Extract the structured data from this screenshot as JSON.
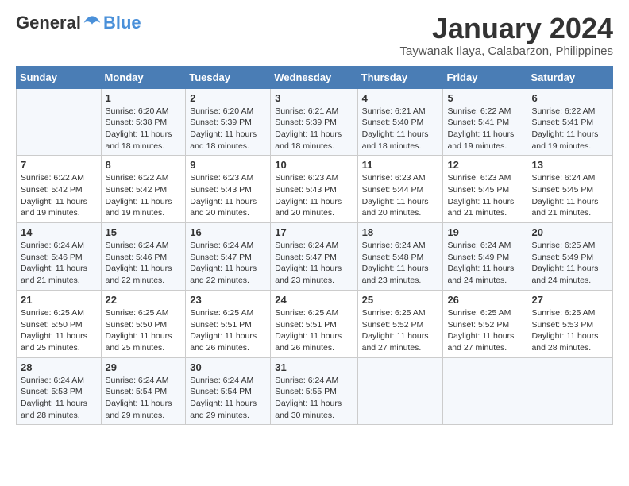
{
  "logo": {
    "text_general": "General",
    "text_blue": "Blue"
  },
  "title": "January 2024",
  "location": "Taywanak Ilaya, Calabarzon, Philippines",
  "headers": [
    "Sunday",
    "Monday",
    "Tuesday",
    "Wednesday",
    "Thursday",
    "Friday",
    "Saturday"
  ],
  "weeks": [
    [
      {
        "day": "",
        "info": ""
      },
      {
        "day": "1",
        "info": "Sunrise: 6:20 AM\nSunset: 5:38 PM\nDaylight: 11 hours\nand 18 minutes."
      },
      {
        "day": "2",
        "info": "Sunrise: 6:20 AM\nSunset: 5:39 PM\nDaylight: 11 hours\nand 18 minutes."
      },
      {
        "day": "3",
        "info": "Sunrise: 6:21 AM\nSunset: 5:39 PM\nDaylight: 11 hours\nand 18 minutes."
      },
      {
        "day": "4",
        "info": "Sunrise: 6:21 AM\nSunset: 5:40 PM\nDaylight: 11 hours\nand 18 minutes."
      },
      {
        "day": "5",
        "info": "Sunrise: 6:22 AM\nSunset: 5:41 PM\nDaylight: 11 hours\nand 19 minutes."
      },
      {
        "day": "6",
        "info": "Sunrise: 6:22 AM\nSunset: 5:41 PM\nDaylight: 11 hours\nand 19 minutes."
      }
    ],
    [
      {
        "day": "7",
        "info": "Sunrise: 6:22 AM\nSunset: 5:42 PM\nDaylight: 11 hours\nand 19 minutes."
      },
      {
        "day": "8",
        "info": "Sunrise: 6:22 AM\nSunset: 5:42 PM\nDaylight: 11 hours\nand 19 minutes."
      },
      {
        "day": "9",
        "info": "Sunrise: 6:23 AM\nSunset: 5:43 PM\nDaylight: 11 hours\nand 20 minutes."
      },
      {
        "day": "10",
        "info": "Sunrise: 6:23 AM\nSunset: 5:43 PM\nDaylight: 11 hours\nand 20 minutes."
      },
      {
        "day": "11",
        "info": "Sunrise: 6:23 AM\nSunset: 5:44 PM\nDaylight: 11 hours\nand 20 minutes."
      },
      {
        "day": "12",
        "info": "Sunrise: 6:23 AM\nSunset: 5:45 PM\nDaylight: 11 hours\nand 21 minutes."
      },
      {
        "day": "13",
        "info": "Sunrise: 6:24 AM\nSunset: 5:45 PM\nDaylight: 11 hours\nand 21 minutes."
      }
    ],
    [
      {
        "day": "14",
        "info": "Sunrise: 6:24 AM\nSunset: 5:46 PM\nDaylight: 11 hours\nand 21 minutes."
      },
      {
        "day": "15",
        "info": "Sunrise: 6:24 AM\nSunset: 5:46 PM\nDaylight: 11 hours\nand 22 minutes."
      },
      {
        "day": "16",
        "info": "Sunrise: 6:24 AM\nSunset: 5:47 PM\nDaylight: 11 hours\nand 22 minutes."
      },
      {
        "day": "17",
        "info": "Sunrise: 6:24 AM\nSunset: 5:47 PM\nDaylight: 11 hours\nand 23 minutes."
      },
      {
        "day": "18",
        "info": "Sunrise: 6:24 AM\nSunset: 5:48 PM\nDaylight: 11 hours\nand 23 minutes."
      },
      {
        "day": "19",
        "info": "Sunrise: 6:24 AM\nSunset: 5:49 PM\nDaylight: 11 hours\nand 24 minutes."
      },
      {
        "day": "20",
        "info": "Sunrise: 6:25 AM\nSunset: 5:49 PM\nDaylight: 11 hours\nand 24 minutes."
      }
    ],
    [
      {
        "day": "21",
        "info": "Sunrise: 6:25 AM\nSunset: 5:50 PM\nDaylight: 11 hours\nand 25 minutes."
      },
      {
        "day": "22",
        "info": "Sunrise: 6:25 AM\nSunset: 5:50 PM\nDaylight: 11 hours\nand 25 minutes."
      },
      {
        "day": "23",
        "info": "Sunrise: 6:25 AM\nSunset: 5:51 PM\nDaylight: 11 hours\nand 26 minutes."
      },
      {
        "day": "24",
        "info": "Sunrise: 6:25 AM\nSunset: 5:51 PM\nDaylight: 11 hours\nand 26 minutes."
      },
      {
        "day": "25",
        "info": "Sunrise: 6:25 AM\nSunset: 5:52 PM\nDaylight: 11 hours\nand 27 minutes."
      },
      {
        "day": "26",
        "info": "Sunrise: 6:25 AM\nSunset: 5:52 PM\nDaylight: 11 hours\nand 27 minutes."
      },
      {
        "day": "27",
        "info": "Sunrise: 6:25 AM\nSunset: 5:53 PM\nDaylight: 11 hours\nand 28 minutes."
      }
    ],
    [
      {
        "day": "28",
        "info": "Sunrise: 6:24 AM\nSunset: 5:53 PM\nDaylight: 11 hours\nand 28 minutes."
      },
      {
        "day": "29",
        "info": "Sunrise: 6:24 AM\nSunset: 5:54 PM\nDaylight: 11 hours\nand 29 minutes."
      },
      {
        "day": "30",
        "info": "Sunrise: 6:24 AM\nSunset: 5:54 PM\nDaylight: 11 hours\nand 29 minutes."
      },
      {
        "day": "31",
        "info": "Sunrise: 6:24 AM\nSunset: 5:55 PM\nDaylight: 11 hours\nand 30 minutes."
      },
      {
        "day": "",
        "info": ""
      },
      {
        "day": "",
        "info": ""
      },
      {
        "day": "",
        "info": ""
      }
    ]
  ]
}
